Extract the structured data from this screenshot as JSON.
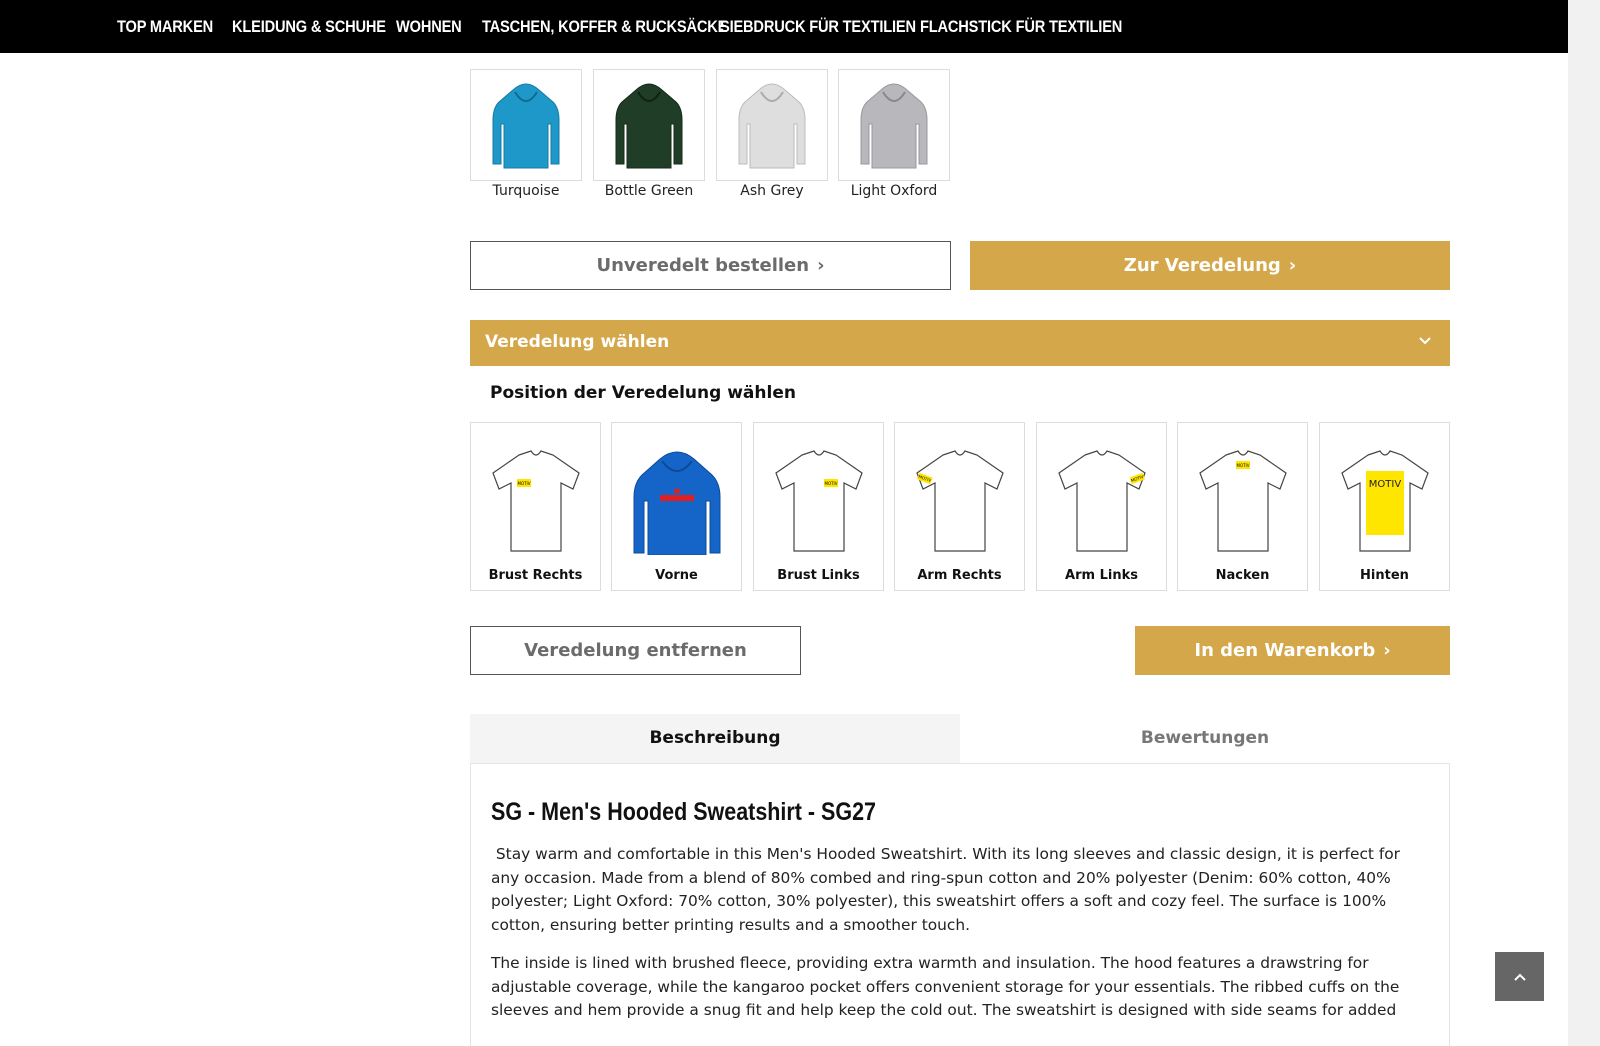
{
  "nav": {
    "items": [
      "TOP MARKEN",
      "KLEIDUNG & SCHUHE",
      "WOHNEN",
      "TASCHEN, KOFFER & RUCKSÄCKE",
      "SIEBDRUCK FÜR TEXTILIEN",
      "FLACHSTICK FÜR TEXTILIEN"
    ]
  },
  "colors": {
    "accent": "#d4a74b",
    "nav_bg": "#000000",
    "swatches": [
      {
        "label": "Turquoise",
        "fill": "#1e98c9",
        "icon": "hoodie-icon"
      },
      {
        "label": "Bottle Green",
        "fill": "#1f3d27",
        "icon": "hoodie-icon"
      },
      {
        "label": "Ash Grey",
        "fill": "#d9d9d9",
        "icon": "hoodie-icon"
      },
      {
        "label": "Light Oxford",
        "fill": "#b8b8bc",
        "icon": "hoodie-icon"
      }
    ]
  },
  "actions": {
    "order_plain": "Unveredelt bestellen",
    "to_finishing": "Zur Veredelung",
    "remove_finishing": "Veredelung entfernen",
    "add_to_cart": "In den Warenkorb"
  },
  "finishing": {
    "accordion_title": "Veredelung wählen",
    "position_heading": "Position der Veredelung wählen",
    "motif_text": "MOTIV",
    "positions": [
      {
        "label": "Brust Rechts",
        "icon": "tshirt-chest-right-icon"
      },
      {
        "label": "Vorne",
        "icon": "hoodie-front-print-icon"
      },
      {
        "label": "Brust Links",
        "icon": "tshirt-chest-left-icon"
      },
      {
        "label": "Arm Rechts",
        "icon": "tshirt-arm-right-icon"
      },
      {
        "label": "Arm Links",
        "icon": "tshirt-arm-left-icon"
      },
      {
        "label": "Nacken",
        "icon": "tshirt-neck-icon"
      },
      {
        "label": "Hinten",
        "icon": "tshirt-back-icon"
      }
    ]
  },
  "tabs": {
    "description": "Beschreibung",
    "reviews": "Bewertungen"
  },
  "product": {
    "title": "SG - Men's Hooded Sweatshirt - SG27",
    "paragraph1": " Stay warm and comfortable in this Men's Hooded Sweatshirt. With its long sleeves and classic design, it is perfect for any occasion. Made from a blend of 80% combed and ring-spun cotton and 20% polyester (Denim: 60% cotton, 40% polyester; Light Oxford: 70% cotton, 30% polyester), this sweatshirt offers a soft and cozy feel. The surface is 100% cotton, ensuring better printing results and a smoother touch.",
    "paragraph2": "The inside is lined with brushed fleece, providing extra warmth and insulation. The hood features a drawstring for adjustable coverage, while the kangaroo pocket offers convenient storage for your essentials. The ribbed cuffs on the sleeves and hem provide a snug fit and help keep the cold out. The sweatshirt is designed with side seams for added"
  }
}
